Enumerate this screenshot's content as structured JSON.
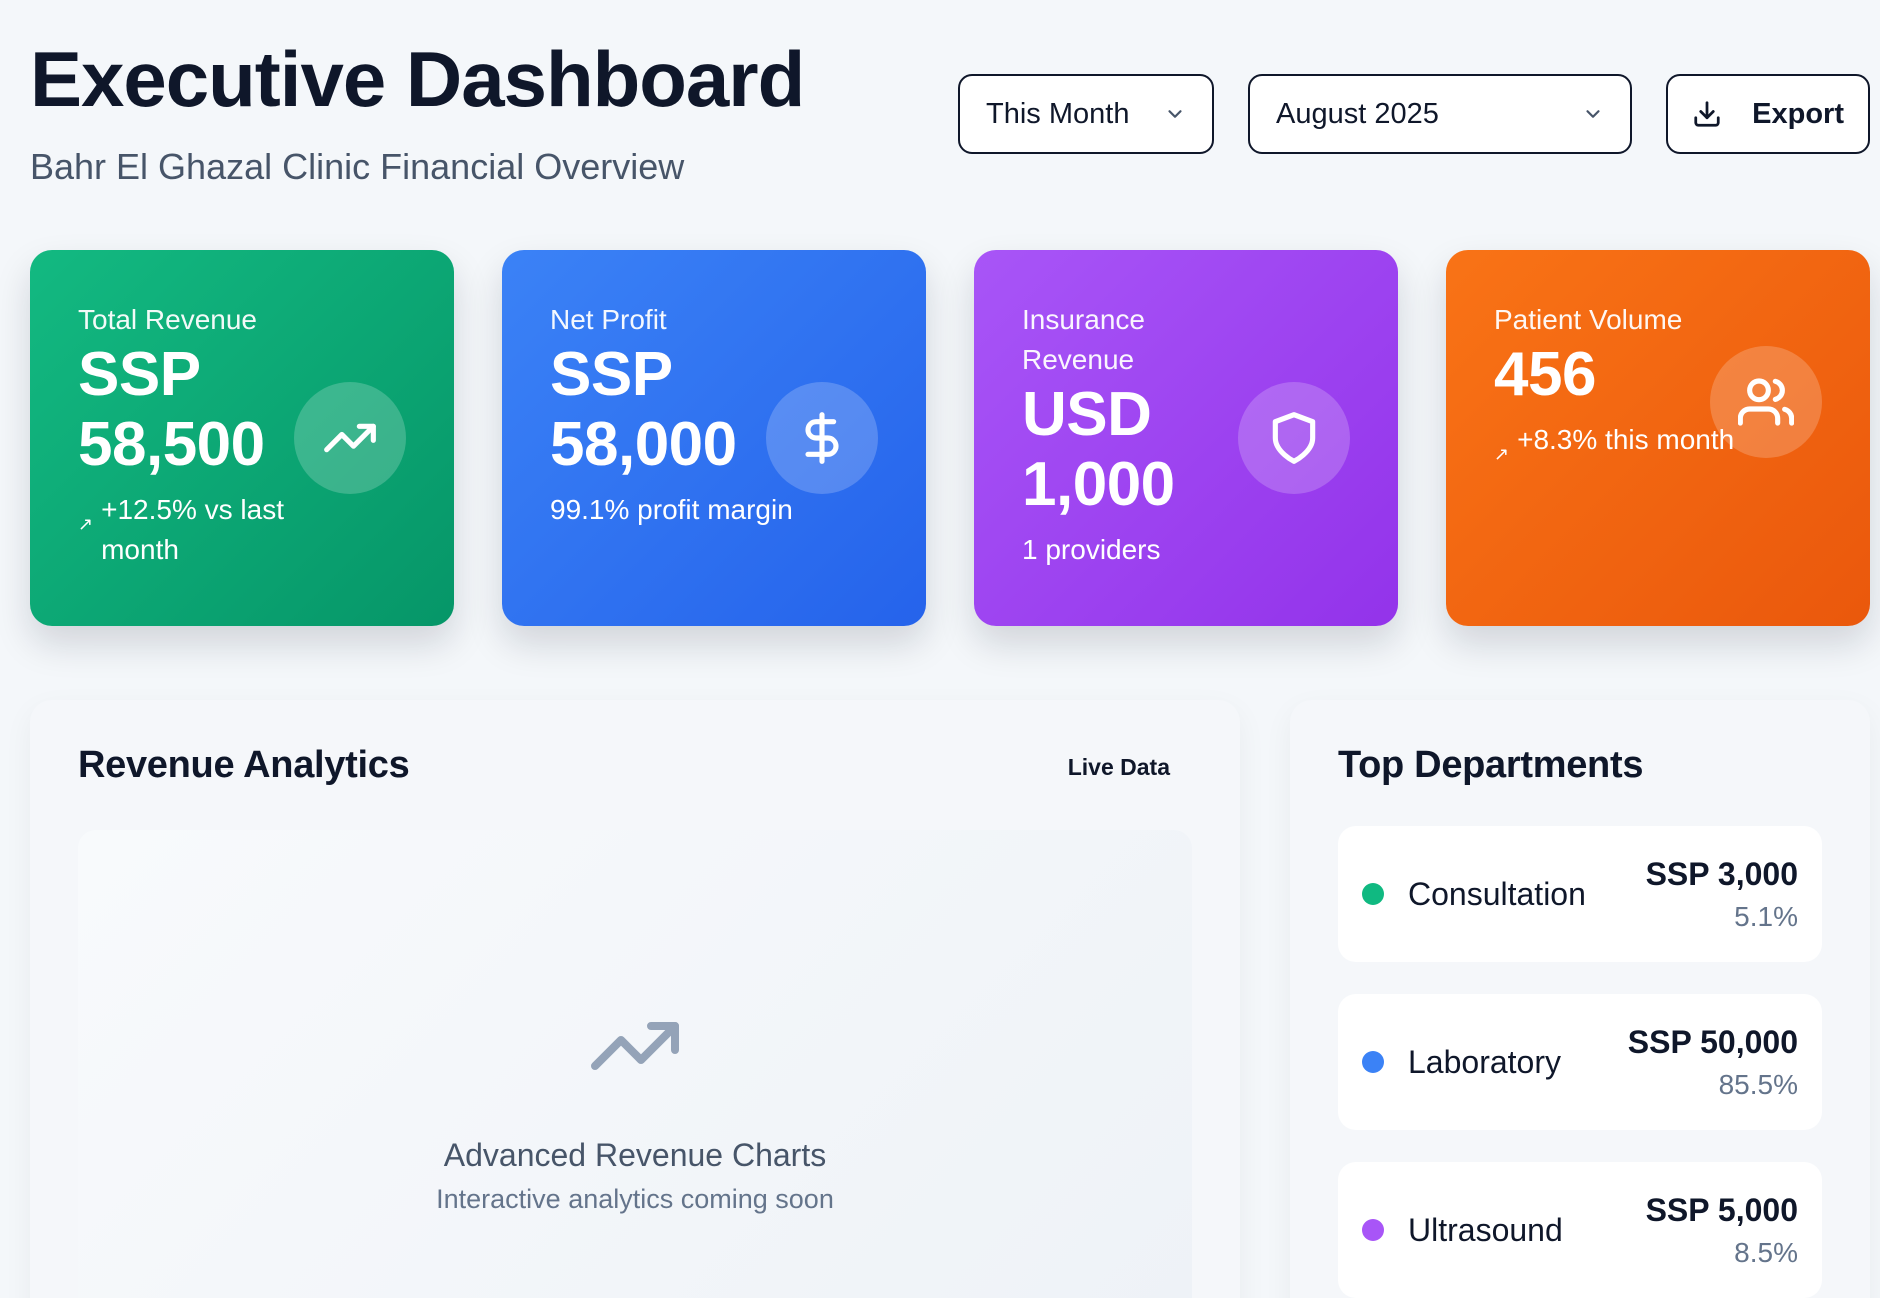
{
  "header": {
    "title": "Executive Dashboard",
    "subtitle": "Bahr El Ghazal Clinic Financial Overview"
  },
  "controls": {
    "period_select": "This Month",
    "month_select": "August 2025",
    "export_label": "Export"
  },
  "kpis": [
    {
      "label": "Total Revenue",
      "value": "SSP 58,500",
      "sub": "+12.5% vs last month",
      "icon": "trending-up-icon",
      "color": "#10b981"
    },
    {
      "label": "Net Profit",
      "value": "SSP 58,000",
      "sub": "99.1% profit margin",
      "icon": "dollar-icon",
      "color": "#3b82f6"
    },
    {
      "label": "Insurance Revenue",
      "value": "USD 1,000",
      "sub": "1 providers",
      "icon": "shield-icon",
      "color": "#a855f7"
    },
    {
      "label": "Patient Volume",
      "value": "456",
      "sub": "+8.3% this month",
      "icon": "users-icon",
      "color": "#f97316"
    }
  ],
  "analytics": {
    "title": "Revenue Analytics",
    "badge": "Live Data",
    "placeholder_title": "Advanced Revenue Charts",
    "placeholder_sub": "Interactive analytics coming soon"
  },
  "departments": {
    "title": "Top Departments",
    "items": [
      {
        "name": "Consultation",
        "value": "SSP 3,000",
        "percent": "5.1%",
        "color": "#10b981"
      },
      {
        "name": "Laboratory",
        "value": "SSP 50,000",
        "percent": "85.5%",
        "color": "#3b82f6"
      },
      {
        "name": "Ultrasound",
        "value": "SSP 5,000",
        "percent": "8.5%",
        "color": "#a855f7"
      }
    ]
  }
}
